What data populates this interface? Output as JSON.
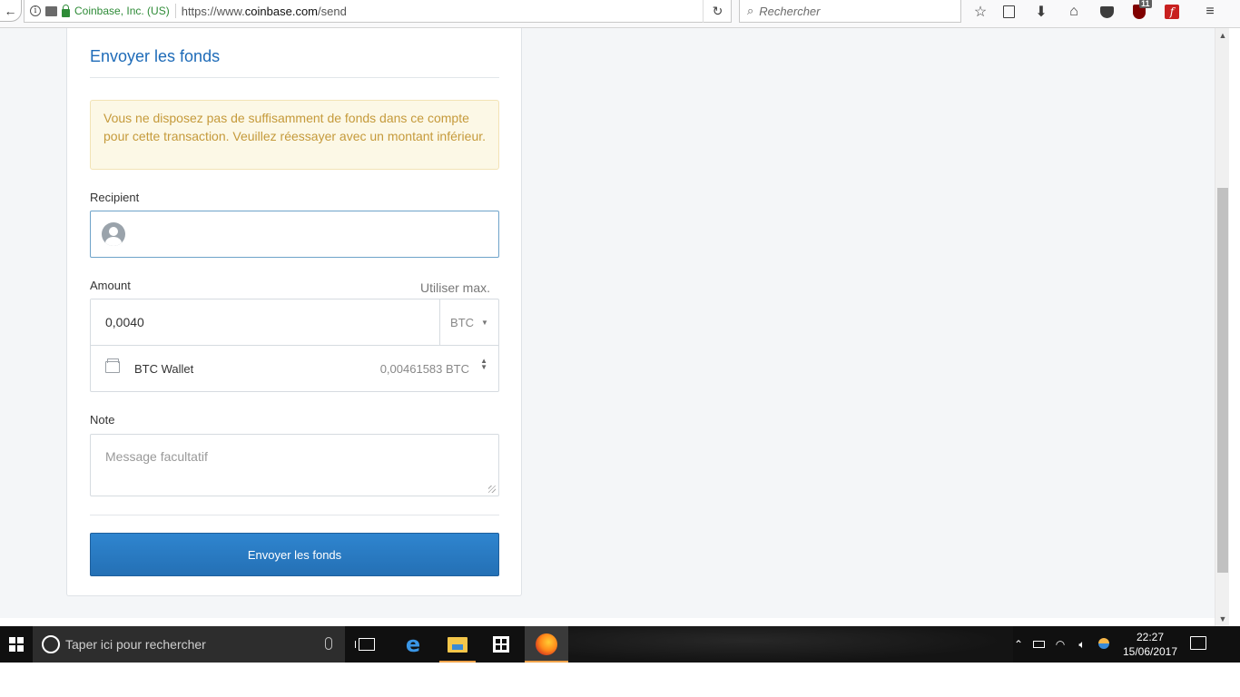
{
  "browser": {
    "identity": "Coinbase, Inc. (US)",
    "url_prefix": "https://www.",
    "url_domain": "coinbase.com",
    "url_path": "/send",
    "search_placeholder": "Rechercher",
    "ublock_count": "11"
  },
  "form": {
    "title": "Envoyer les fonds",
    "warning": "Vous ne disposez pas de suffisamment de fonds dans ce compte pour cette transaction. Veuillez réessayer avec un montant inférieur.",
    "recipient_label": "Recipient",
    "recipient_value": "",
    "amount_label": "Amount",
    "use_max": "Utiliser max.",
    "amount_value": "0,0040",
    "currency": "BTC",
    "wallet_name": "BTC Wallet",
    "wallet_balance": "0,00461583 BTC",
    "note_label": "Note",
    "note_placeholder": "Message facultatif",
    "submit_label": "Envoyer les fonds"
  },
  "taskbar": {
    "search_placeholder": "Taper ici pour rechercher",
    "time": "22:27",
    "date": "15/06/2017"
  },
  "colors": {
    "accent": "#1e6bb8",
    "button": "#2470b5",
    "warning_bg": "#fcf8e6",
    "warning_text": "#c59a3b",
    "identity_green": "#2e8b37"
  }
}
